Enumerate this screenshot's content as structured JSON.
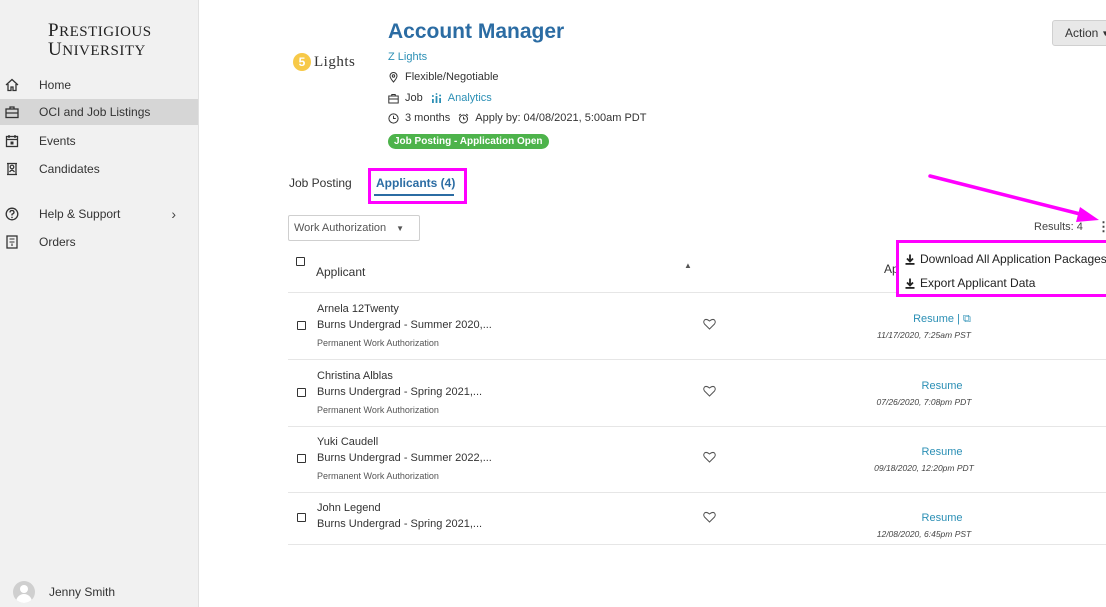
{
  "sidebar": {
    "logo_line1": "Prestigious",
    "logo_line2": "University",
    "items": [
      {
        "label": "Home"
      },
      {
        "label": "OCI and Job Listings"
      },
      {
        "label": "Events"
      },
      {
        "label": "Candidates"
      },
      {
        "label": "Help & Support"
      },
      {
        "label": "Orders"
      }
    ],
    "user_name": "Jenny Smith"
  },
  "job": {
    "company_logo_letter": "5",
    "company_logo_text": "Lights",
    "title": "Account Manager",
    "company": "Z Lights",
    "location": "Flexible/Negotiable",
    "type": "Job",
    "category": "Analytics",
    "duration": "3 months",
    "apply_by": "Apply by: 04/08/2021, 5:00am PDT",
    "status_badge": "Job Posting - Application Open",
    "action_label": "Action"
  },
  "tabs": {
    "job_posting": "Job Posting",
    "applicants": "Applicants (4)"
  },
  "filter": {
    "label": "Work Authorization"
  },
  "results_label": "Results: 4",
  "table": {
    "header_applicant": "Applicant",
    "header_partial": "Ap",
    "rows": [
      {
        "name": "Arnela 12Twenty",
        "program": "Burns Undergrad - Summer 2020,...",
        "auth": "Permanent Work Authorization",
        "resume": "Resume  |  ",
        "date": "11/17/2020, 7:25am PST"
      },
      {
        "name": "Christina Alblas",
        "program": "Burns Undergrad - Spring 2021,...",
        "auth": "Permanent Work Authorization",
        "resume": "Resume",
        "date": "07/26/2020, 7:08pm PDT"
      },
      {
        "name": "Yuki Caudell",
        "program": "Burns Undergrad - Summer 2022,...",
        "auth": "Permanent Work Authorization",
        "resume": "Resume",
        "date": "09/18/2020, 12:20pm PDT"
      },
      {
        "name": "John Legend",
        "program": "Burns Undergrad - Spring 2021,...",
        "auth": "",
        "resume": "Resume",
        "date": "12/08/2020, 6:45pm PST"
      }
    ]
  },
  "dropdown": {
    "items": [
      {
        "label": "Download All Application Packages"
      },
      {
        "label": "Export Applicant Data"
      }
    ]
  },
  "colors": {
    "accent": "#2b6ca3",
    "link": "#2b8fb5",
    "badge": "#4db34b",
    "highlight": "#ff00ff"
  }
}
